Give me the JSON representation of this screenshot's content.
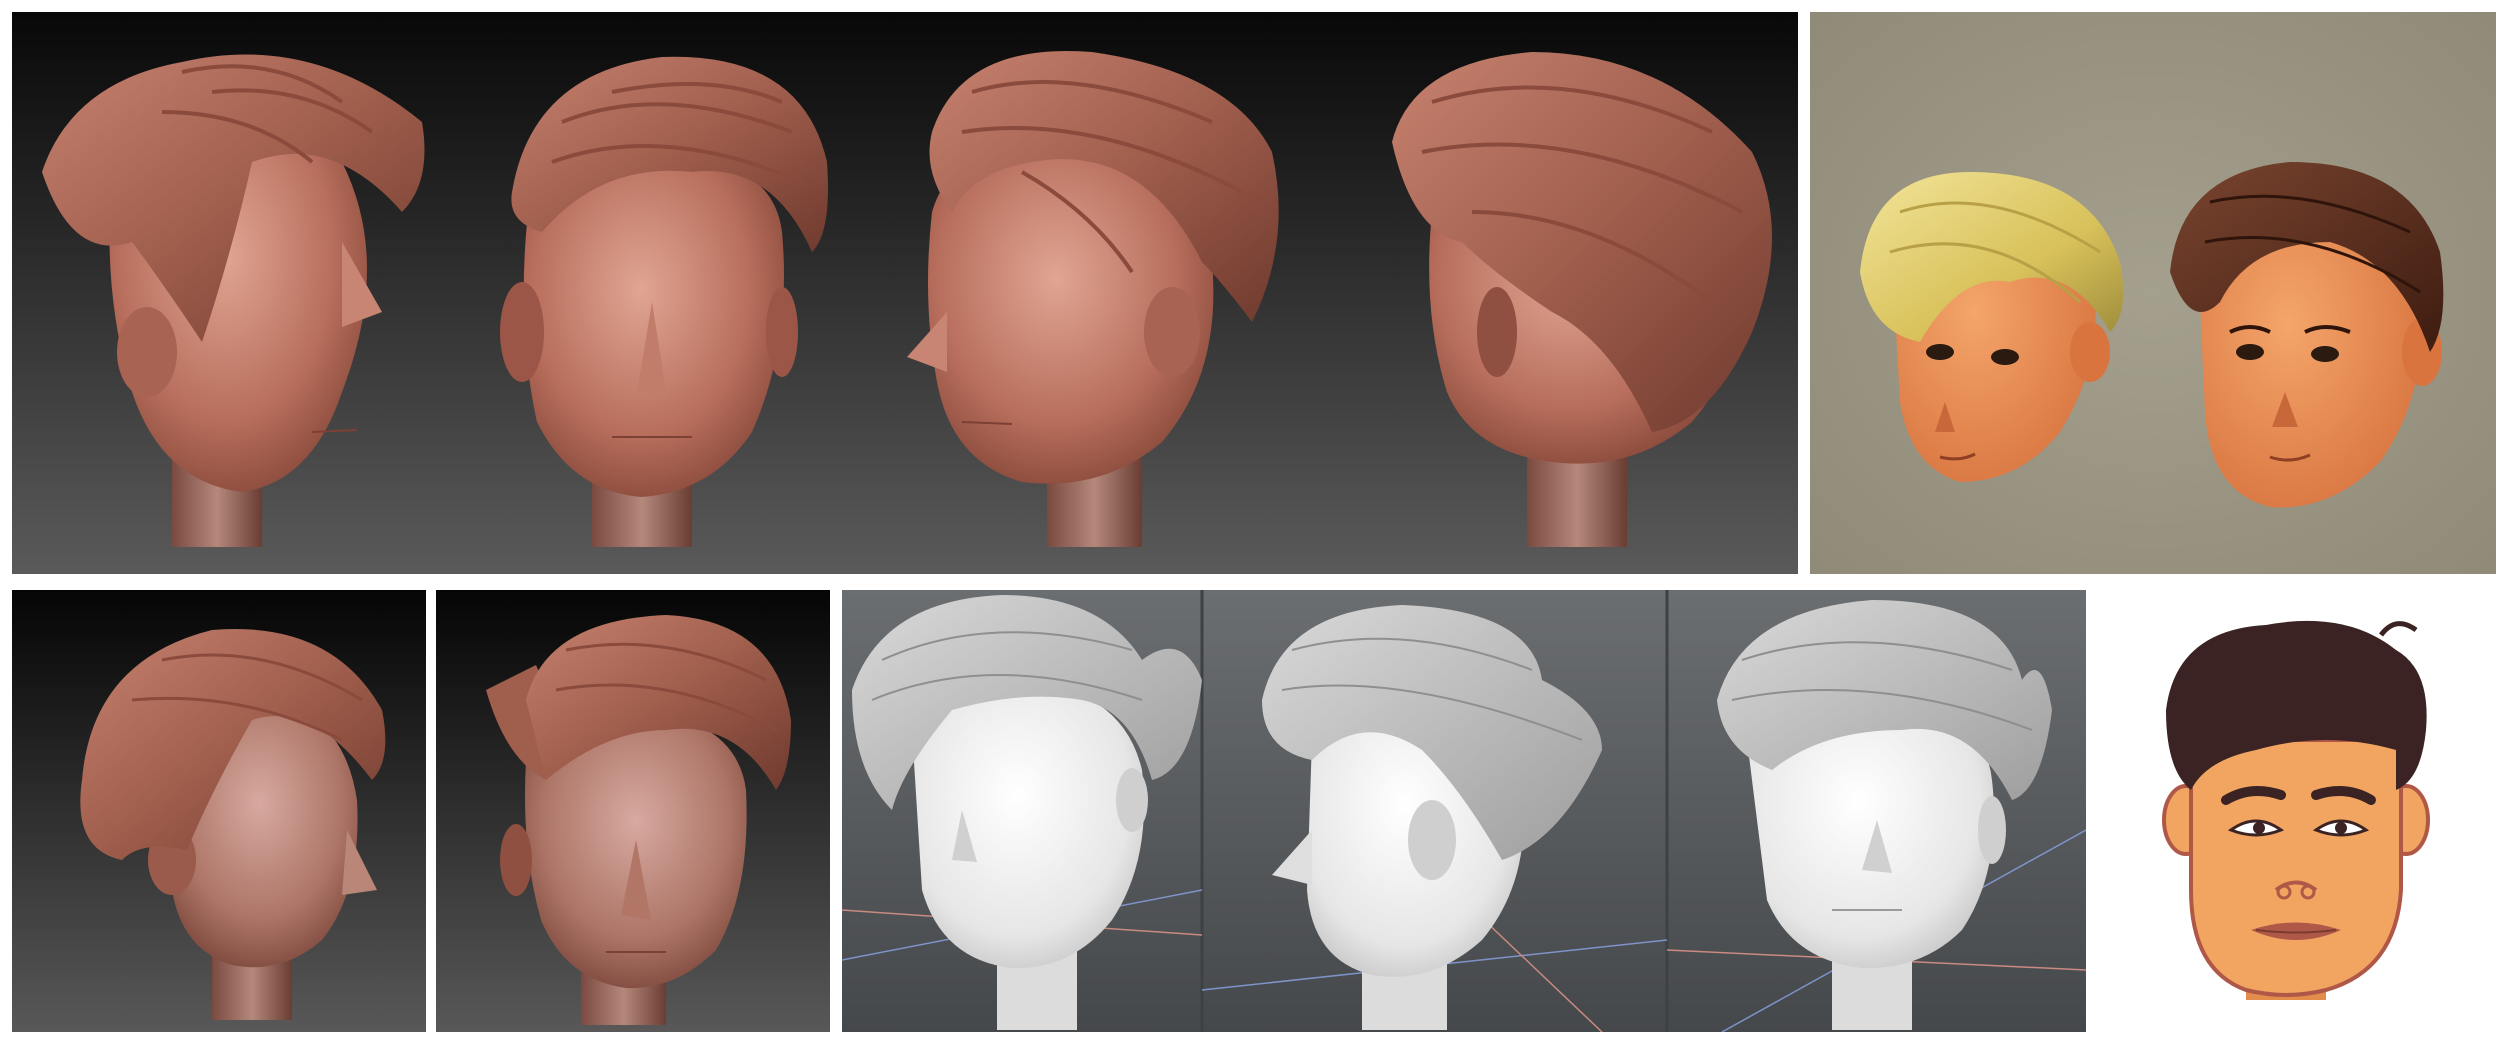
{
  "panels": [
    {
      "id": "clay-turnaround",
      "views": [
        "three-quarter-left",
        "front",
        "three-quarter-right",
        "back-three-quarter"
      ]
    },
    {
      "id": "textured-render",
      "heads": [
        "blond-hair",
        "brown-hair"
      ]
    },
    {
      "id": "clay-three-quarter"
    },
    {
      "id": "clay-front"
    },
    {
      "id": "gray-lowpoly-views",
      "views": [
        "front-three-quarter",
        "side",
        "front"
      ]
    },
    {
      "id": "concept-illustration"
    }
  ],
  "colors": {
    "clay": "#b86e5c",
    "clay_dark": "#6f3a2e",
    "clay_light": "#d99c8a",
    "viewport_top": "#0a0a0a",
    "viewport_bottom": "#5a5a5a",
    "beige_bg": "#9c9684",
    "gray_model": "#e3e3e3",
    "gray_bg": "#56595c",
    "skin_render": "#e98a55",
    "blond": "#e4cf6e",
    "brown": "#5a2e1d",
    "concept_skin": "#f1a561",
    "concept_hair": "#3a2322",
    "concept_lips": "#b05848"
  }
}
